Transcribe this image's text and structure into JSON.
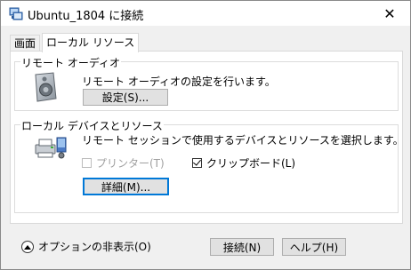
{
  "window": {
    "title": "Ubuntu_1804 に接続",
    "close_glyph": "✕"
  },
  "tabs": [
    {
      "label": "画面",
      "active": false
    },
    {
      "label": "ローカル リソース",
      "active": true
    }
  ],
  "remote_audio": {
    "group_label": "リモート オーディオ",
    "description": "リモート オーディオの設定を行います。",
    "settings_button": "設定(S)..."
  },
  "local_devices": {
    "group_label": "ローカル デバイスとリソース",
    "description": "リモート セッションで使用するデバイスとリソースを選択します。",
    "printer_label": "プリンター(T)",
    "printer_checked": false,
    "printer_enabled": false,
    "clipboard_label": "クリップボード(L)",
    "clipboard_checked": true,
    "details_button": "詳細(M)..."
  },
  "footer": {
    "hide_options_label": "オプションの非表示(O)",
    "connect_button": "接続(N)",
    "help_button": "ヘルプ(H)"
  },
  "colors": {
    "accent": "#0078d7",
    "button_bg": "#e1e1e1",
    "panel_bg": "#ffffff",
    "window_bg": "#f0f0f0"
  }
}
